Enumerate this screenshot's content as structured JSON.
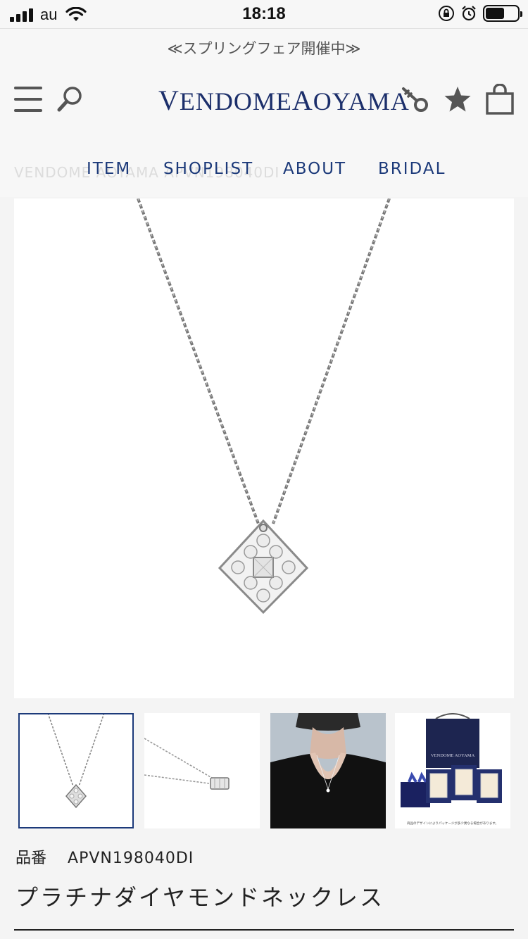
{
  "status_bar": {
    "carrier": "au",
    "time": "18:18",
    "battery_level": 0.6
  },
  "header": {
    "promo": "≪スプリングフェア開催中≫",
    "logo": {
      "part1_initial": "V",
      "part1_rest": "ENDOME",
      "part2_initial": "A",
      "part2_rest": "OYAMA"
    },
    "icons": [
      "menu-icon",
      "search-icon",
      "key-icon",
      "star-icon",
      "shopping-bag-icon"
    ],
    "ghost_breadcrumb": "VENDOME AOYAMA APVN198040DI",
    "nav": [
      "ITEM",
      "SHOPLIST",
      "ABOUT",
      "BRIDAL"
    ]
  },
  "thumbnails": {
    "box_brand": "VENDOME AOYAMA",
    "box_caption": "商品のデザインによりパッケージが多少異なる場合があります。"
  },
  "product": {
    "sku_label": "品番",
    "sku": "APVN198040DI",
    "name": "プラチナダイヤモンドネックレス"
  },
  "colors": {
    "brand_navy": "#1c3a7a",
    "logo_navy": "#1c2f6b",
    "icon_gray": "#555555"
  }
}
